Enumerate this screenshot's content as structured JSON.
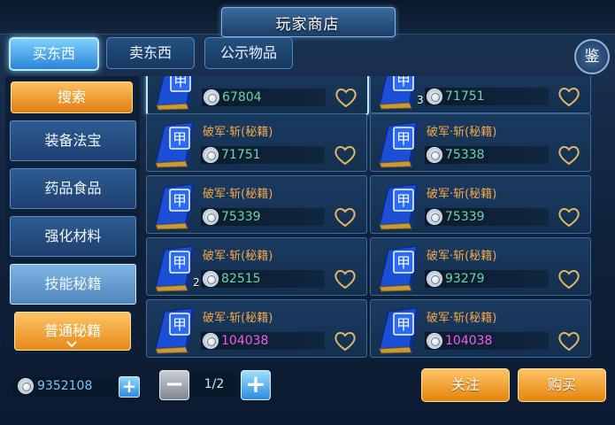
{
  "window": {
    "title": "玩家商店"
  },
  "tabs": [
    {
      "label": "买东西",
      "active": true
    },
    {
      "label": "卖东西",
      "active": false
    },
    {
      "label": "公示物品",
      "active": false
    }
  ],
  "appraise_button": {
    "label": "鉴"
  },
  "sidebar": {
    "search_label": "搜索",
    "categories": [
      {
        "label": "装备法宝",
        "active": false
      },
      {
        "label": "药品食品",
        "active": false
      },
      {
        "label": "强化材料",
        "active": false
      },
      {
        "label": "技能秘籍",
        "active": true
      }
    ],
    "subcategory_label": "普通秘籍",
    "expand_icon": "chevron-down-icon"
  },
  "items": [
    {
      "name": "",
      "price": "67804",
      "price_color": "#6fd4a1",
      "quantity": "",
      "selected": true
    },
    {
      "name": "",
      "price": "71751",
      "price_color": "#6fd4a1",
      "quantity": "3",
      "selected": false
    },
    {
      "name": "破军·斩(秘籍)",
      "price": "71751",
      "price_color": "#6fd4a1",
      "quantity": "",
      "selected": false
    },
    {
      "name": "破军·斩(秘籍)",
      "price": "75338",
      "price_color": "#6fd4a1",
      "quantity": "",
      "selected": false
    },
    {
      "name": "破军·斩(秘籍)",
      "price": "75339",
      "price_color": "#6fd4a1",
      "quantity": "",
      "selected": false
    },
    {
      "name": "破军·斩(秘籍)",
      "price": "75339",
      "price_color": "#6fd4a1",
      "quantity": "",
      "selected": false
    },
    {
      "name": "破军·斩(秘籍)",
      "price": "82515",
      "price_color": "#6fd4a1",
      "quantity": "2",
      "selected": false
    },
    {
      "name": "破军·斩(秘籍)",
      "price": "93279",
      "price_color": "#6fd4a1",
      "quantity": "",
      "selected": false
    },
    {
      "name": "破军·斩(秘籍)",
      "price": "104038",
      "price_color": "#ee5ee8",
      "quantity": "",
      "selected": false
    },
    {
      "name": "破军·斩(秘籍)",
      "price": "104038",
      "price_color": "#ee5ee8",
      "quantity": "",
      "selected": false
    }
  ],
  "item_icon_char": "甲",
  "footer": {
    "silver": "9352108",
    "add_silver_label": "+",
    "prev_page_label": "−",
    "page_indicator": "1/2",
    "next_page_label": "+",
    "follow_label": "关注",
    "buy_label": "购买"
  }
}
